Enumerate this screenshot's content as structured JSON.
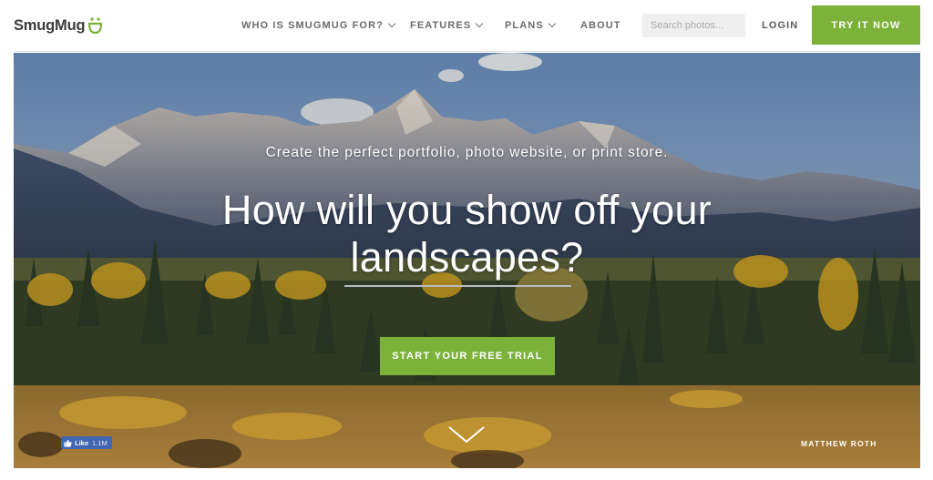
{
  "header": {
    "logo_text": "SmugMug",
    "logo_icon": "smiley-face-icon",
    "nav": [
      {
        "label": "WHO IS SMUGMUG FOR?",
        "has_dropdown": true
      },
      {
        "label": "FEATURES",
        "has_dropdown": true
      },
      {
        "label": "PLANS",
        "has_dropdown": true
      },
      {
        "label": "ABOUT",
        "has_dropdown": false
      }
    ],
    "search": {
      "placeholder": "Search photos...",
      "value": ""
    },
    "login_label": "LOGIN",
    "try_label": "TRY IT NOW"
  },
  "hero": {
    "subtitle": "Create the perfect portfolio, photo website, or print store.",
    "headline_line1": "How will you show off your",
    "headline_line2": "landscapes?",
    "cta_label": "START YOUR FREE TRIAL",
    "scroll_icon": "chevron-down-icon",
    "photo_credit": "MATTHEW ROTH",
    "fb_like": {
      "label": "Like",
      "count": "1.1M"
    }
  },
  "colors": {
    "accent": "#7cb13a",
    "nav_text": "#6b6b6b",
    "facebook": "#4267b2"
  }
}
